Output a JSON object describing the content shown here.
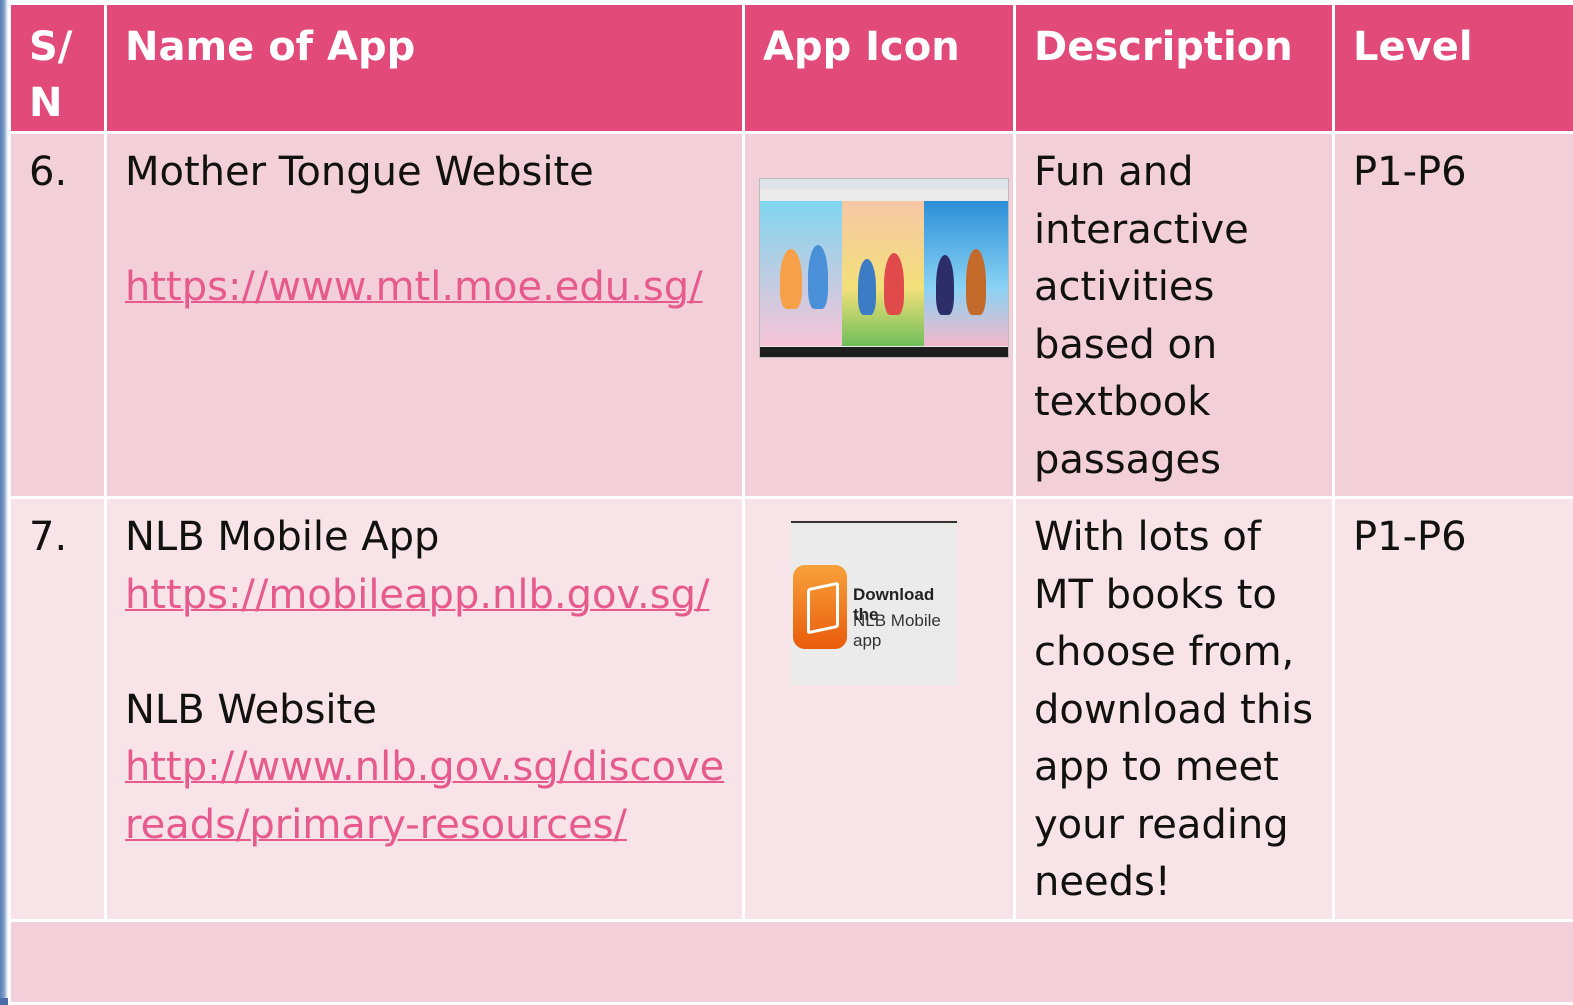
{
  "table": {
    "headers": [
      "S/ N",
      "Name of App",
      "App Icon",
      "Description",
      "Level"
    ],
    "rows": [
      {
        "sn": "6.",
        "name": "Mother Tongue Website",
        "link": "https://www.mtl.moe.edu.sg/",
        "description_lines": [
          "Fun and",
          "interactive",
          "activities",
          "based on",
          "textbook",
          "passages"
        ],
        "level": "P1-P6",
        "icon": "mtl-website-screenshot"
      },
      {
        "sn": "7.",
        "name": "NLB Mobile App",
        "link": "https://mobileapp.nlb.gov.sg/",
        "name2": "NLB Website",
        "link2_lines": [
          "http://www.nlb.gov.sg/discove",
          "reads/primary-resources/"
        ],
        "description_lines": [
          "With lots of",
          "MT books to",
          "choose from,",
          "download this",
          "app to meet",
          "your reading",
          "needs!"
        ],
        "level": "P1-P6",
        "icon": "nlb-mobile-app-logo",
        "icon_text_1": "Download the",
        "icon_text_2": "NLB Mobile app"
      }
    ]
  },
  "colors": {
    "header": "#e24a7a",
    "row_a": "#f3d0d9",
    "row_b": "#f7e3e8",
    "link": "#e75a8d"
  }
}
